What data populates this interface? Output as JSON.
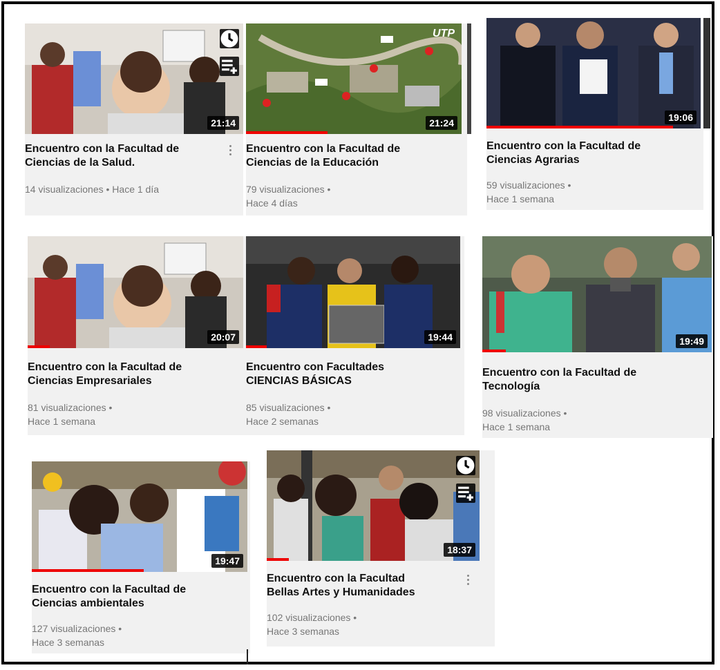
{
  "videos": [
    {
      "title": "Encuentro con la Facultad de\nCiencias de la Salud.",
      "meta": "14 visualizaciones • Hace 1 día",
      "duration": "21:14"
    },
    {
      "title": "Encuentro con la Facultad de\nCiencias de la Educación",
      "meta": "79 visualizaciones •\nHace 4 días",
      "duration": "21:24",
      "logo": "UTP"
    },
    {
      "title": "Encuentro con la Facultad de\nCiencias Agrarias",
      "meta": "59 visualizaciones •\nHace 1 semana",
      "duration": "19:06"
    },
    {
      "title": "Encuentro con la Facultad de\nCiencias Empresariales",
      "meta": "81 visualizaciones •\nHace 1 semana",
      "duration": "20:07"
    },
    {
      "title": "Encuentro con Facultades\nCIENCIAS BÁSICAS",
      "meta": "85 visualizaciones •\nHace 2 semanas",
      "duration": "19:44"
    },
    {
      "title": "Encuentro con la Facultad de\nTecnología",
      "meta": "98 visualizaciones •\nHace 1 semana",
      "duration": "19:49"
    },
    {
      "title": "Encuentro con la Facultad de\nCiencias ambientales",
      "meta": "127 visualizaciones •\nHace 3 semanas",
      "duration": "19:47"
    },
    {
      "title": "Encuentro con la Facultad\nBellas Artes y Humanidades",
      "meta": "102 visualizaciones •\nHace 3 semanas",
      "duration": "18:37"
    }
  ],
  "colors": {
    "progress": "#e00000",
    "card_bg": "#f1f1f1",
    "title": "#111111",
    "meta": "#777777"
  },
  "icons": {
    "watch_later": "clock-icon",
    "add_to_queue": "queue-icon",
    "more": "kebab-icon"
  }
}
